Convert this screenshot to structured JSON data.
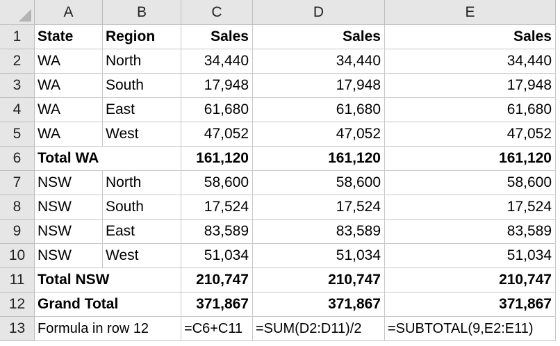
{
  "columns": [
    "A",
    "B",
    "C",
    "D",
    "E"
  ],
  "rows": [
    {
      "num": "1",
      "cells": [
        "State",
        "Region",
        "Sales",
        "Sales",
        "Sales"
      ],
      "bold": true,
      "header": true
    },
    {
      "num": "2",
      "cells": [
        "WA",
        "North",
        "34,440",
        "34,440",
        "34,440"
      ]
    },
    {
      "num": "3",
      "cells": [
        "WA",
        "South",
        "17,948",
        "17,948",
        "17,948"
      ]
    },
    {
      "num": "4",
      "cells": [
        "WA",
        "East",
        "61,680",
        "61,680",
        "61,680"
      ]
    },
    {
      "num": "5",
      "cells": [
        "WA",
        "West",
        "47,052",
        "47,052",
        "47,052"
      ]
    },
    {
      "num": "6",
      "cells": [
        "Total WA",
        "",
        "161,120",
        "161,120",
        "161,120"
      ],
      "bold": true,
      "span": true
    },
    {
      "num": "7",
      "cells": [
        "NSW",
        "North",
        "58,600",
        "58,600",
        "58,600"
      ]
    },
    {
      "num": "8",
      "cells": [
        "NSW",
        "South",
        "17,524",
        "17,524",
        "17,524"
      ]
    },
    {
      "num": "9",
      "cells": [
        "NSW",
        "East",
        "83,589",
        "83,589",
        "83,589"
      ]
    },
    {
      "num": "10",
      "cells": [
        "NSW",
        "West",
        "51,034",
        "51,034",
        "51,034"
      ]
    },
    {
      "num": "11",
      "cells": [
        "Total NSW",
        "",
        "210,747",
        "210,747",
        "210,747"
      ],
      "bold": true,
      "span": true
    },
    {
      "num": "12",
      "cells": [
        "Grand Total",
        "",
        "371,867",
        "371,867",
        "371,867"
      ],
      "bold": true,
      "span": true
    },
    {
      "num": "13",
      "cells": [
        "Formula in row 12",
        "",
        "=C6+C11",
        "=SUM(D2:D11)/2",
        "=SUBTOTAL(9,E2:E11)"
      ],
      "span": true,
      "formula": true
    }
  ]
}
